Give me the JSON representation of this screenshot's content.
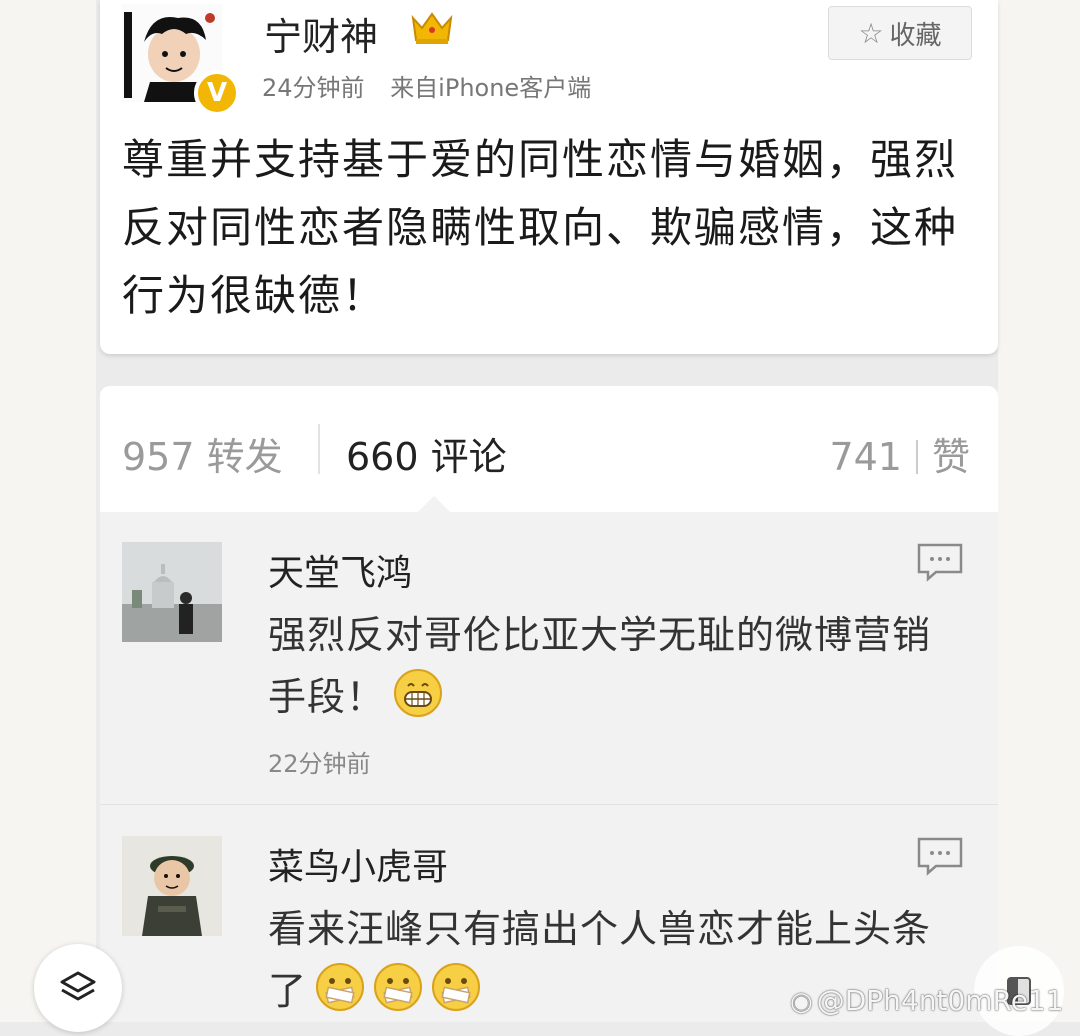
{
  "post": {
    "username": "宁财神",
    "time": "24分钟前",
    "source": "来自iPhone客户端",
    "favorite_label": "收藏",
    "verified_mark": "V",
    "text": "尊重并支持基于爱的同性恋情与婚姻，强烈反对同性恋者隐瞒性取向、欺骗感情，这种行为很缺德！"
  },
  "stats": {
    "repost": "957 转发",
    "comments": "660 评论",
    "likes_count": "741",
    "likes_label": "赞"
  },
  "comments": [
    {
      "name": "天堂飞鸿",
      "text": "强烈反对哥伦比亚大学无耻的微博营销手段！",
      "emoji": "grin-emoji",
      "time": "22分钟前"
    },
    {
      "name": "菜鸟小虎哥",
      "text": "看来汪峰只有搞出个人兽恋才能上头条了",
      "emoji": "sealed-mouth-emoji"
    }
  ],
  "watermark": "@DPh4nt0mRe11",
  "colors": {
    "crown": "#f2b705",
    "verified": "#f2b705",
    "card_bg": "#ffffff",
    "comments_bg": "#f2f2f2"
  }
}
